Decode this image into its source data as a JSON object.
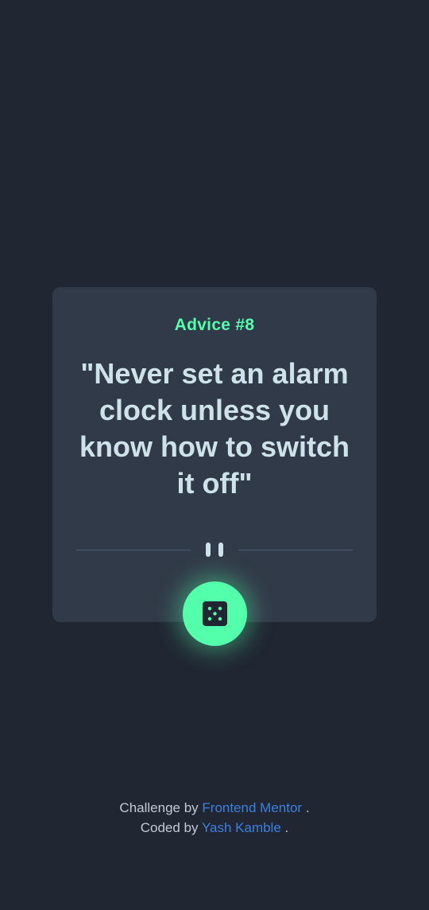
{
  "card": {
    "advice_label": "Advice #8",
    "quote": "\"Never set an alarm clock unless you know how to switch it off\""
  },
  "dice_button": {
    "icon": "dice-icon"
  },
  "divider": {
    "icon": "pause-icon"
  },
  "attribution": {
    "line1_prefix": "Challenge by",
    "line1_link": "Frontend Mentor",
    "line1_suffix": ".",
    "line2_prefix": "Coded by",
    "line2_link": "Yash Kamble",
    "line2_suffix": "."
  },
  "colors": {
    "background": "#202632",
    "card": "#313a48",
    "accent": "#53ffab",
    "text": "#cee3e9",
    "link": "#3e7fe0"
  }
}
